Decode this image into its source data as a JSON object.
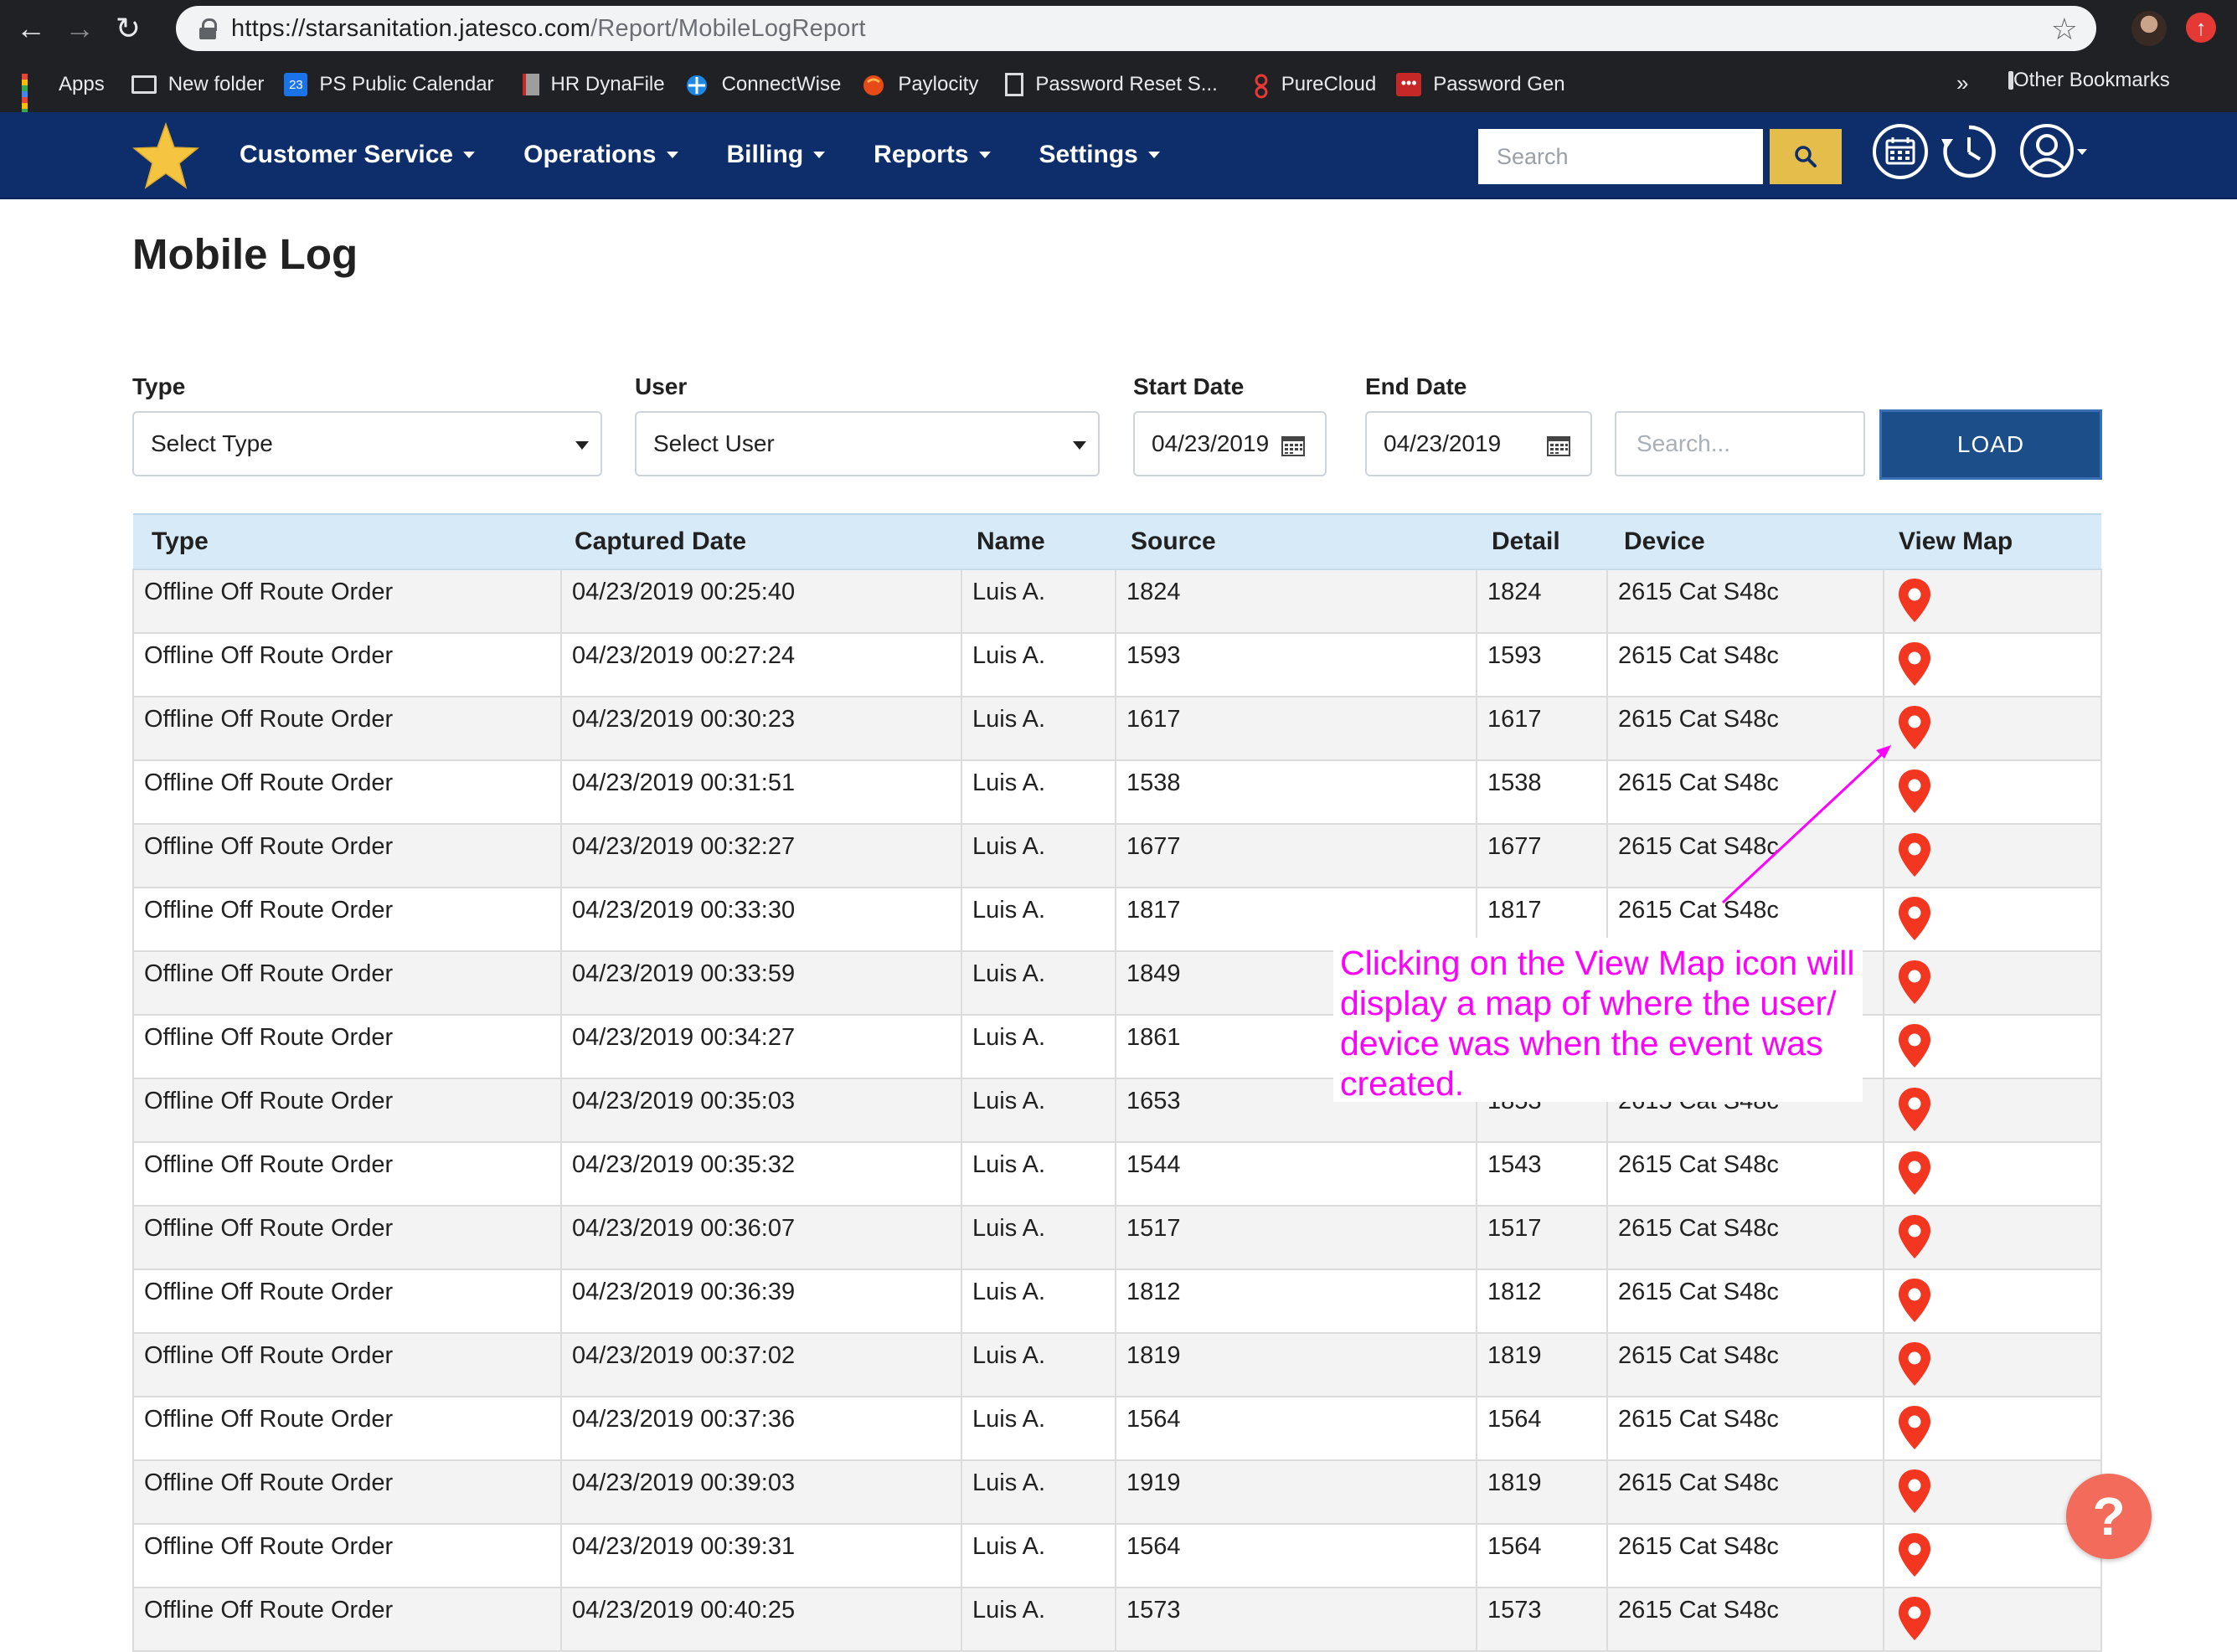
{
  "browser": {
    "url_host": "https://starsanitation.jatesco.com",
    "url_path": "/Report/MobileLogReport",
    "bookmarks": [
      "Apps",
      "New folder",
      "PS Public Calendar",
      "HR DynaFile",
      "ConnectWise",
      "Paylocity",
      "Password Reset S...",
      "PureCloud",
      "Password Gen"
    ],
    "calendar_badge": "23",
    "more": "»",
    "other_bookmarks": "Other Bookmarks"
  },
  "header": {
    "menu": [
      "Customer Service",
      "Operations",
      "Billing",
      "Reports",
      "Settings"
    ],
    "search_placeholder": "Search",
    "brand_color": "#0d2d6b",
    "accent_color": "#e4bd4b"
  },
  "page": {
    "title": "Mobile Log"
  },
  "filters": {
    "type_label": "Type",
    "type_value": "Select Type",
    "user_label": "User",
    "user_value": "Select User",
    "start_label": "Start Date",
    "start_value": "04/23/2019",
    "end_label": "End Date",
    "end_value": "04/23/2019",
    "search_placeholder": "Search...",
    "load_label": "LOAD"
  },
  "table": {
    "columns": [
      "Type",
      "Captured Date",
      "Name",
      "Source",
      "Detail",
      "Device",
      "View Map"
    ],
    "rows": [
      [
        "Offline Off Route Order",
        "04/23/2019 00:25:40",
        "Luis A.",
        "1824",
        "1824",
        "2615 Cat S48c"
      ],
      [
        "Offline Off Route Order",
        "04/23/2019 00:27:24",
        "Luis A.",
        "1593",
        "1593",
        "2615 Cat S48c"
      ],
      [
        "Offline Off Route Order",
        "04/23/2019 00:30:23",
        "Luis A.",
        "1617",
        "1617",
        "2615 Cat S48c"
      ],
      [
        "Offline Off Route Order",
        "04/23/2019 00:31:51",
        "Luis A.",
        "1538",
        "1538",
        "2615 Cat S48c"
      ],
      [
        "Offline Off Route Order",
        "04/23/2019 00:32:27",
        "Luis A.",
        "1677",
        "1677",
        "2615 Cat S48c"
      ],
      [
        "Offline Off Route Order",
        "04/23/2019 00:33:30",
        "Luis A.",
        "1817",
        "1817",
        "2615 Cat S48c"
      ],
      [
        "Offline Off Route Order",
        "04/23/2019 00:33:59",
        "Luis A.",
        "1849",
        "",
        ""
      ],
      [
        "Offline Off Route Order",
        "04/23/2019 00:34:27",
        "Luis A.",
        "1861",
        "",
        ""
      ],
      [
        "Offline Off Route Order",
        "04/23/2019 00:35:03",
        "Luis A.",
        "1653",
        "1853",
        "2615 Cat S48c"
      ],
      [
        "Offline Off Route Order",
        "04/23/2019 00:35:32",
        "Luis A.",
        "1544",
        "1543",
        "2615 Cat S48c"
      ],
      [
        "Offline Off Route Order",
        "04/23/2019 00:36:07",
        "Luis A.",
        "1517",
        "1517",
        "2615 Cat S48c"
      ],
      [
        "Offline Off Route Order",
        "04/23/2019 00:36:39",
        "Luis A.",
        "1812",
        "1812",
        "2615 Cat S48c"
      ],
      [
        "Offline Off Route Order",
        "04/23/2019 00:37:02",
        "Luis A.",
        "1819",
        "1819",
        "2615 Cat S48c"
      ],
      [
        "Offline Off Route Order",
        "04/23/2019 00:37:36",
        "Luis A.",
        "1564",
        "1564",
        "2615 Cat S48c"
      ],
      [
        "Offline Off Route Order",
        "04/23/2019 00:39:03",
        "Luis A.",
        "1919",
        "1819",
        "2615 Cat S48c"
      ],
      [
        "Offline Off Route Order",
        "04/23/2019 00:39:31",
        "Luis A.",
        "1564",
        "1564",
        "2615 Cat S48c"
      ],
      [
        "Offline Off Route Order",
        "04/23/2019 00:40:25",
        "Luis A.",
        "1573",
        "1573",
        "2615 Cat S48c"
      ]
    ],
    "header_bg": "#d6eaf7",
    "pin_color": "#f2361f"
  },
  "annotation": {
    "text": "Clicking on the View Map icon will display a map of where the user/ device was when the event was created.",
    "color": "#ff00ff"
  },
  "help": {
    "label": "?"
  },
  "icons": {
    "back": "arrow-left-icon",
    "forward": "arrow-right-icon",
    "reload": "reload-icon",
    "lock": "lock-icon",
    "bookmark_star": "star-outline-icon",
    "logo": "gold-star-icon",
    "search": "magnifier-icon",
    "calendar": "calendar-icon",
    "clock": "clock-history-icon",
    "account": "user-circle-icon",
    "pin": "map-pin-icon"
  }
}
